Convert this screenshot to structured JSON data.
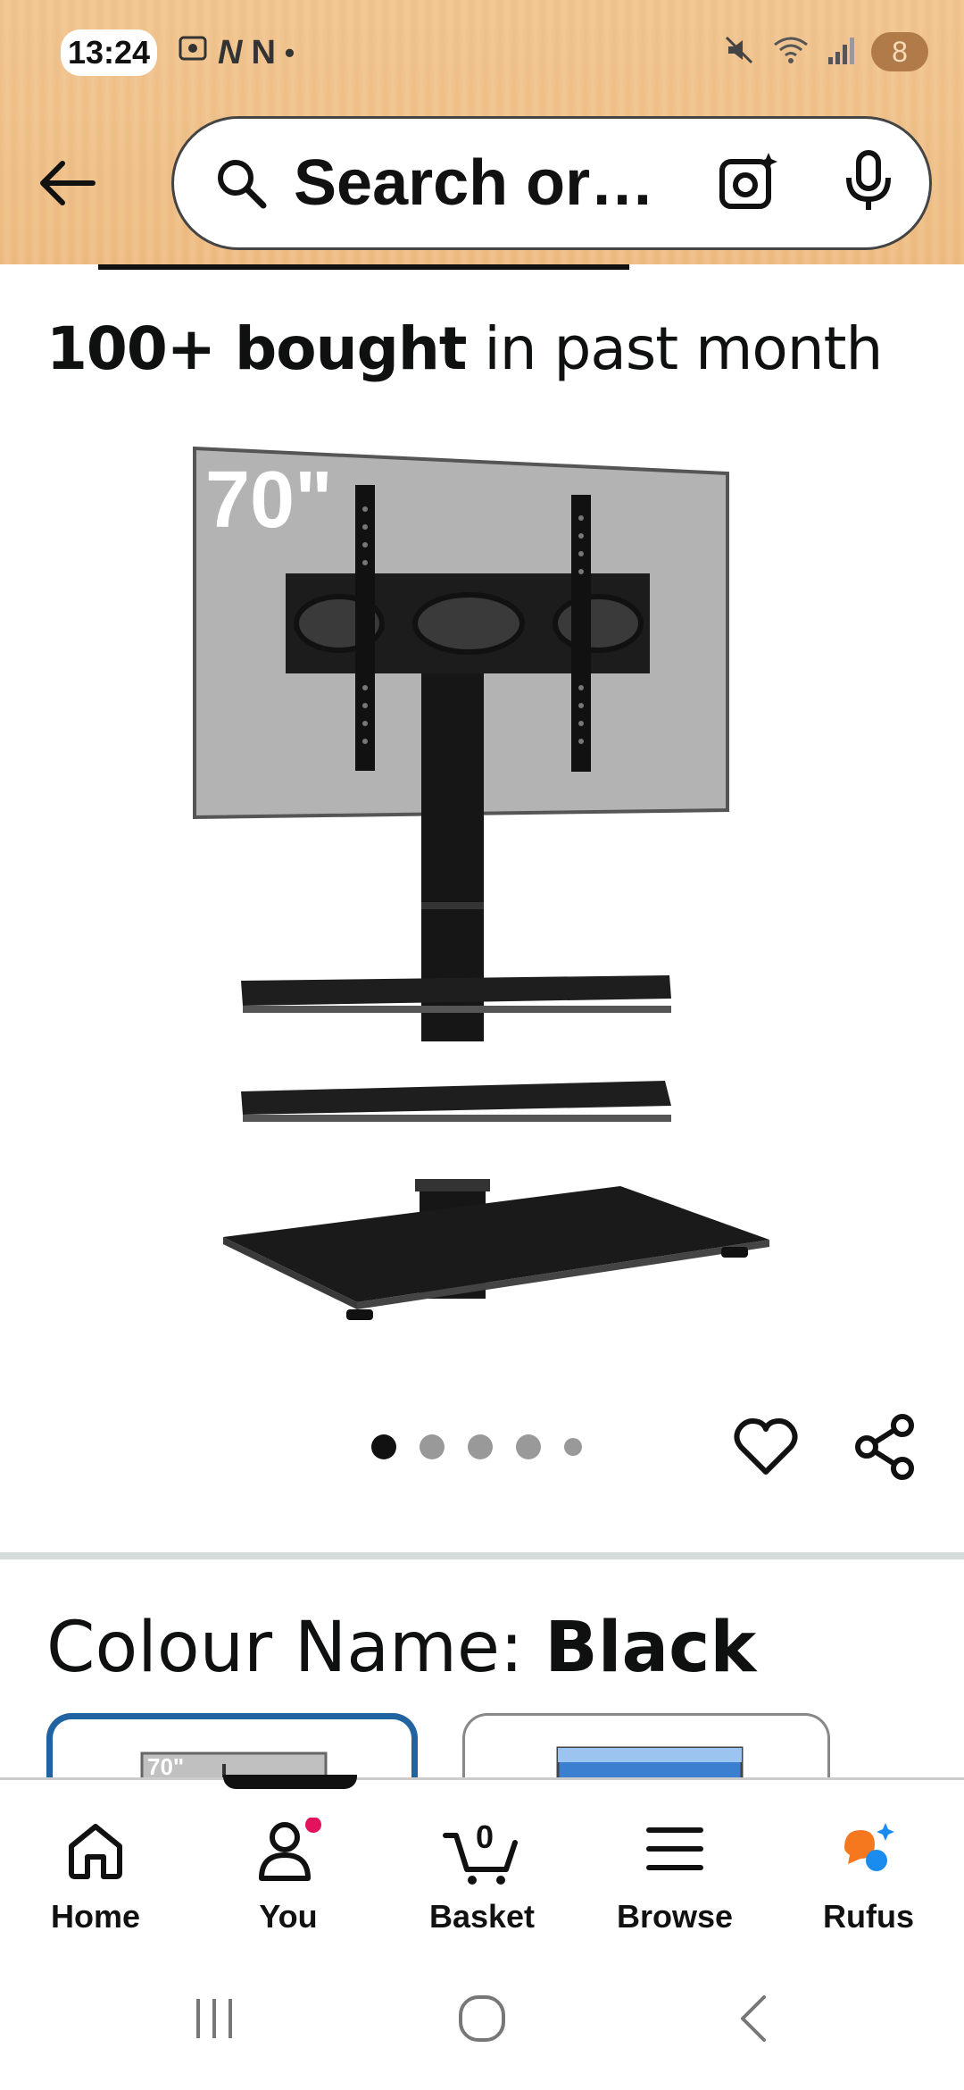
{
  "status_bar": {
    "time": "13:24",
    "left_icons": [
      "screenshot-icon",
      "N",
      "N",
      "•"
    ],
    "right_icons": [
      "mute-icon",
      "wifi-icon",
      "signal-icon"
    ],
    "battery": "8"
  },
  "search": {
    "placeholder": "Search or…",
    "icons": [
      "search-icon",
      "camera-lens-icon",
      "microphone-icon"
    ]
  },
  "product": {
    "bought_bold": "100+ bought",
    "bought_rest": " in past month",
    "image_label": "70\"",
    "carousel": {
      "count": 5,
      "active_index": 0
    }
  },
  "colour": {
    "label": "Colour Name:",
    "value": "Black",
    "swatches": [
      {
        "label": "70\"",
        "selected": true
      },
      {
        "label": "",
        "selected": false
      }
    ]
  },
  "bottom_nav": {
    "items": [
      {
        "label": "Home",
        "icon": "home-icon"
      },
      {
        "label": "You",
        "icon": "user-icon"
      },
      {
        "label": "Basket",
        "icon": "basket-icon",
        "badge": "0"
      },
      {
        "label": "Browse",
        "icon": "menu-icon"
      },
      {
        "label": "Rufus",
        "icon": "rufus-icon"
      }
    ]
  },
  "colors": {
    "header_bg": "#e8b47c",
    "selected_border": "#2162a1",
    "notification_dot": "#e3125c",
    "rufus_orange": "#f5781e",
    "rufus_blue": "#1a8cf0"
  }
}
